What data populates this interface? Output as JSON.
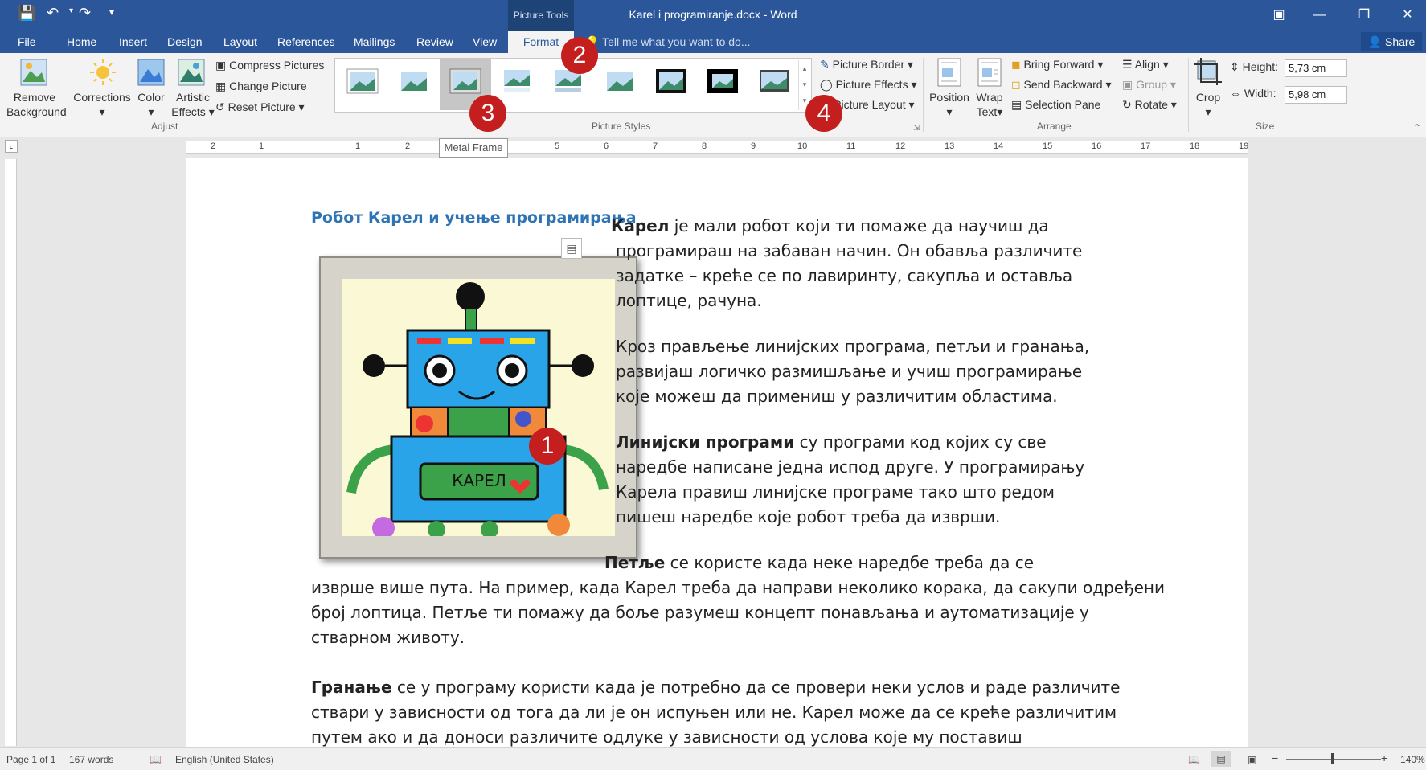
{
  "window": {
    "title": "Karel i programiranje.docx - Word",
    "context_tab_group": "Picture Tools"
  },
  "tabs": [
    "File",
    "Home",
    "Insert",
    "Design",
    "Layout",
    "References",
    "Mailings",
    "Review",
    "View"
  ],
  "active_tab": "Format",
  "tell_me": "Tell me what you want to do...",
  "share_label": "Share",
  "ribbon": {
    "adjust": {
      "remove_background": "Remove Background",
      "remove_bg_line1": "Remove",
      "remove_bg_line2": "Background",
      "corrections": "Corrections",
      "color": "Color",
      "artistic_line1": "Artistic",
      "artistic_line2": "Effects",
      "compress": "Compress Pictures",
      "change": "Change Picture",
      "reset": "Reset Picture",
      "group_label": "Adjust"
    },
    "picture_styles": {
      "border": "Picture Border",
      "effects": "Picture Effects",
      "layout": "Picture Layout",
      "group_label": "Picture Styles"
    },
    "arrange": {
      "position": "Position",
      "wrap_line1": "Wrap",
      "wrap_line2": "Text",
      "bring_forward": "Bring Forward",
      "send_backward": "Send Backward",
      "selection_pane": "Selection Pane",
      "align": "Align",
      "group": "Group",
      "rotate": "Rotate",
      "group_label": "Arrange"
    },
    "size": {
      "crop": "Crop",
      "height_label": "Height:",
      "height_value": "5,73 cm",
      "width_label": "Width:",
      "width_value": "5,98 cm",
      "group_label": "Size"
    }
  },
  "tooltip": "Metal Frame",
  "ruler_numbers": [
    "2",
    "1",
    "1",
    "2",
    "5",
    "6",
    "7",
    "8",
    "9",
    "10",
    "11",
    "12",
    "13",
    "14",
    "15",
    "16",
    "17",
    "18",
    "19"
  ],
  "document": {
    "heading": "Робот Карел и учење програмирања",
    "p1_bold": "Карел",
    "p1_l1": " је мали робот који ти помаже да научиш да",
    "p1_l2": "програмираш на забаван начин. Он обавља различите",
    "p1_l3": "задатке – креће се по лавиринту, сакупља и оставља",
    "p1_l4": "лоптице, рачуна.",
    "p2_l1": "Кроз прављење линијских програма, петљи и гранања,",
    "p2_l2": "развијаш логичко размишљање и учиш програмирање",
    "p2_l3": "које можеш да примениш у различитим областима.",
    "p3_bold": "Линијски програми",
    "p3_l1": " су програми код којих су све",
    "p3_l2": "наредбе написане једна испод друге. У програмирању",
    "p3_l3": "Карела правиш линијске програме тако што редом",
    "p3_l4": "пишеш наредбе које робот треба да изврши.",
    "p4_bold": "Петље",
    "p4_l1": " се користе када неке наредбе треба да се",
    "p4_l2": "изврше више пута. На пример, када Карел треба да направи неколико корака, да сакупи одређени",
    "p4_l3": "број лоптица. Петље ти помажу да боље разумеш концепт понављања и аутоматизације у",
    "p4_l4": "стварном животу.",
    "p5_bold": "Гранање",
    "p5_l1": " се у програму користи када је потребно да се провери неки услов и раде различите",
    "p5_l2": "ствари у зависности од тога да ли је он испуњен или не. Карел може да се креће различитим",
    "p5_l3": "путем ако и да доноси различите одлуке у зависности од услова које му поставиш",
    "robot_label": "КАРЕЛ"
  },
  "callouts": [
    "1",
    "2",
    "3",
    "4"
  ],
  "statusbar": {
    "page": "Page 1 of 1",
    "words": "167 words",
    "language": "English (United States)",
    "zoom": "140%"
  },
  "colors": {
    "accent": "#2b579a",
    "heading": "#2e74b5",
    "callout": "#c41e1e"
  }
}
